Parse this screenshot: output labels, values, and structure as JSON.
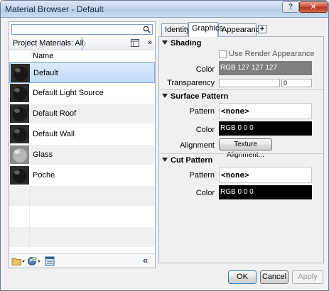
{
  "window": {
    "title": "Material Browser - Default",
    "help_label": "?",
    "close_label": "✕"
  },
  "search": {
    "value": "",
    "placeholder": ""
  },
  "filter": {
    "label": "Project Materials: All",
    "more": "»"
  },
  "list": {
    "column_header": "Name",
    "selected_index": 0,
    "items": [
      {
        "name": "Default",
        "icon": "dark-sphere-icon"
      },
      {
        "name": "Default Light Source",
        "icon": "dark-sphere-icon"
      },
      {
        "name": "Default Roof",
        "icon": "dark-sphere-icon"
      },
      {
        "name": "Default Wall",
        "icon": "dark-sphere-icon"
      },
      {
        "name": "Glass",
        "icon": "glass-sphere-icon"
      },
      {
        "name": "Poche",
        "icon": "dark-sphere-icon"
      }
    ]
  },
  "left_toolbar": {
    "collapse": "«"
  },
  "tabs": [
    {
      "label": "Identity",
      "active": false
    },
    {
      "label": "Graphics",
      "active": true
    },
    {
      "label": "Appearance",
      "active": false
    }
  ],
  "tab_add": "+",
  "shading": {
    "title": "Shading",
    "use_render_label": "Use Render Appearance",
    "use_render_checked": false,
    "color_label": "Color",
    "color_value": "RGB 127 127 127",
    "color_hex": "#7f7f7f",
    "transparency_label": "Transparency",
    "transparency_value": "0"
  },
  "surface_pattern": {
    "title": "Surface Pattern",
    "pattern_label": "Pattern",
    "pattern_value": "<none>",
    "color_label": "Color",
    "color_value": "RGB 0 0 0",
    "color_hex": "#000000",
    "alignment_label": "Alignment",
    "alignment_button": "Texture Alignment..."
  },
  "cut_pattern": {
    "title": "Cut Pattern",
    "pattern_label": "Pattern",
    "pattern_value": "<none>",
    "color_label": "Color",
    "color_value": "RGB 0 0 0",
    "color_hex": "#000000"
  },
  "footer": {
    "ok": "OK",
    "cancel": "Cancel",
    "apply": "Apply"
  }
}
